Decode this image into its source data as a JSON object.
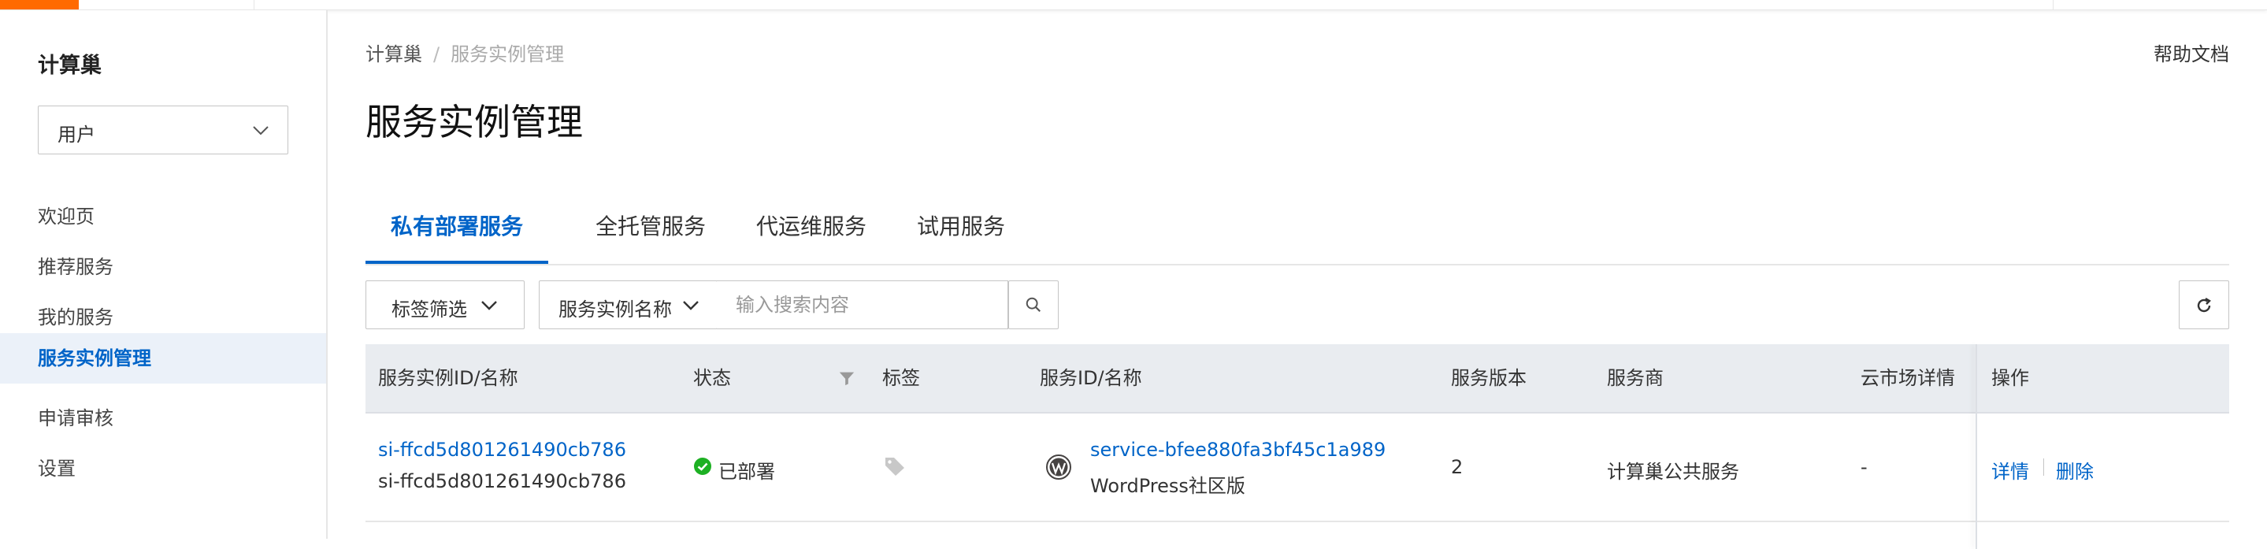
{
  "sidebar": {
    "title": "计算巢",
    "role_select": "用户",
    "items": [
      {
        "label": "欢迎页"
      },
      {
        "label": "推荐服务"
      },
      {
        "label": "我的服务"
      },
      {
        "label": "服务实例管理"
      },
      {
        "label": "申请审核"
      },
      {
        "label": "设置"
      }
    ]
  },
  "header": {
    "breadcrumb": [
      "计算巢",
      "服务实例管理"
    ],
    "help": "帮助文档",
    "title": "服务实例管理"
  },
  "tabs": [
    {
      "label": "私有部署服务"
    },
    {
      "label": "全托管服务"
    },
    {
      "label": "代运维服务"
    },
    {
      "label": "试用服务"
    }
  ],
  "toolbar": {
    "tag_filter": "标签筛选",
    "search_field": "服务实例名称",
    "search_placeholder": "输入搜索内容"
  },
  "table": {
    "columns": [
      "服务实例ID/名称",
      "状态",
      "标签",
      "服务ID/名称",
      "服务版本",
      "服务商",
      "云市场详情",
      "操作"
    ],
    "rows": [
      {
        "instance_id": "si-ffcd5d801261490cb786",
        "instance_name": "si-ffcd5d801261490cb786",
        "status": "已部署",
        "service_id": "service-bfee880fa3bf45c1a989",
        "service_name": "WordPress社区版",
        "version": "2",
        "provider": "计算巢公共服务",
        "marketplace": "-",
        "action_detail": "详情",
        "action_delete": "删除"
      }
    ]
  },
  "colors": {
    "brand": "#ff6a00",
    "link": "#0064c8",
    "success": "#1db023",
    "active_bg": "#ebf1f9"
  },
  "icons": [
    "chevron-down-icon",
    "search-icon",
    "refresh-icon",
    "filter-icon",
    "tag-icon",
    "wordpress-icon",
    "check-circle-icon"
  ]
}
